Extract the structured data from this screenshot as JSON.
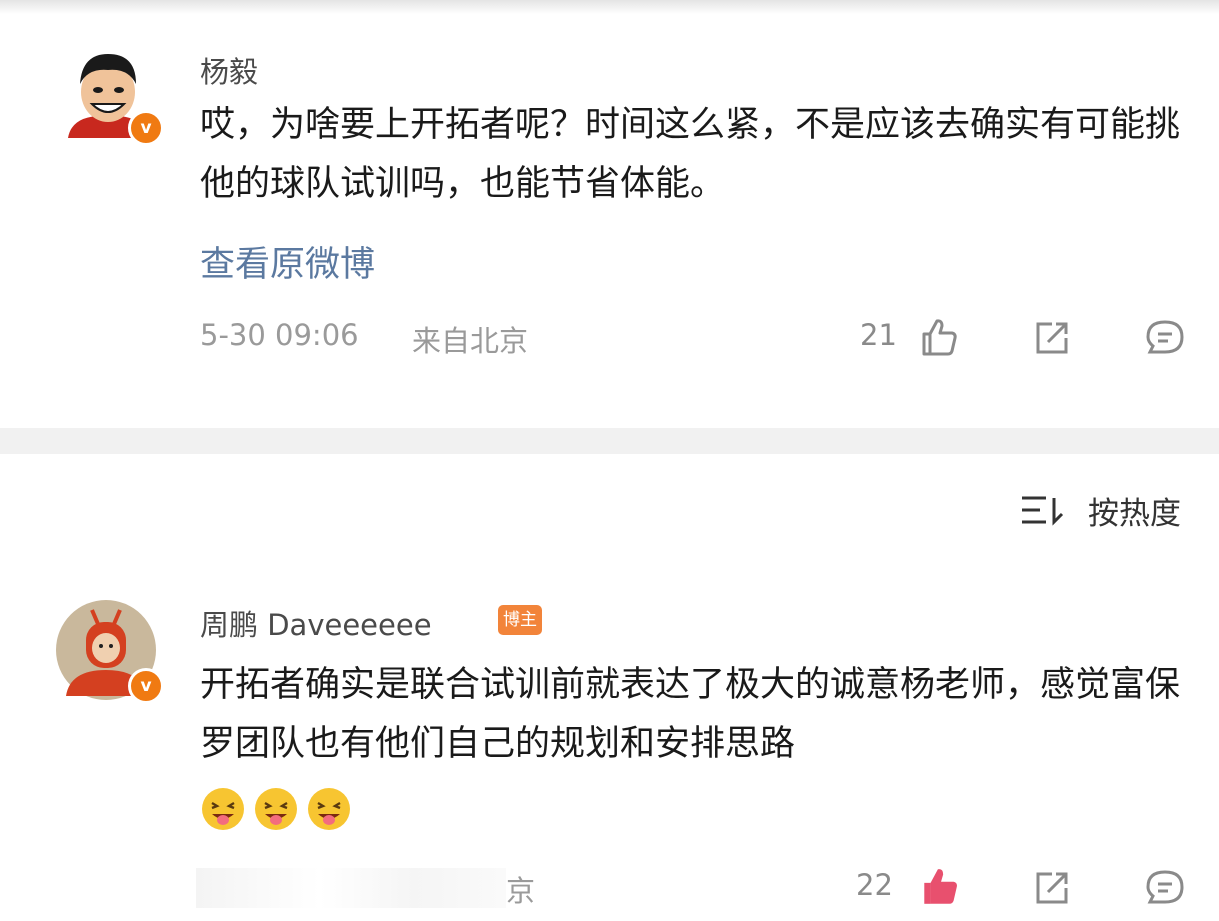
{
  "comment1": {
    "username": "杨毅",
    "text": "哎，为啥要上开拓者呢？时间这么紧，不是应该去确实有可能挑他的球队试训吗，也能节省体能。",
    "link": "查看原微博",
    "date": "5-30 09:06",
    "location": "来自北京",
    "likes": "21",
    "verified_badge": "v"
  },
  "sort": {
    "label": "按热度"
  },
  "comment2": {
    "username": "周鹏 Daveeeeee",
    "author_badge": "博主",
    "text": "开拓者确实是联合试训前就表达了极大的诚意杨老师，感觉富保罗团队也有他们自己的规划和安排思路",
    "emoji": [
      "grin-tongue-emoji",
      "grin-tongue-emoji",
      "grin-tongue-emoji"
    ],
    "location_partial": "京",
    "likes": "22",
    "verified_badge": "v"
  },
  "colors": {
    "accent": "#f07a12",
    "link": "#5b79a0",
    "liked": "#e8506e"
  }
}
